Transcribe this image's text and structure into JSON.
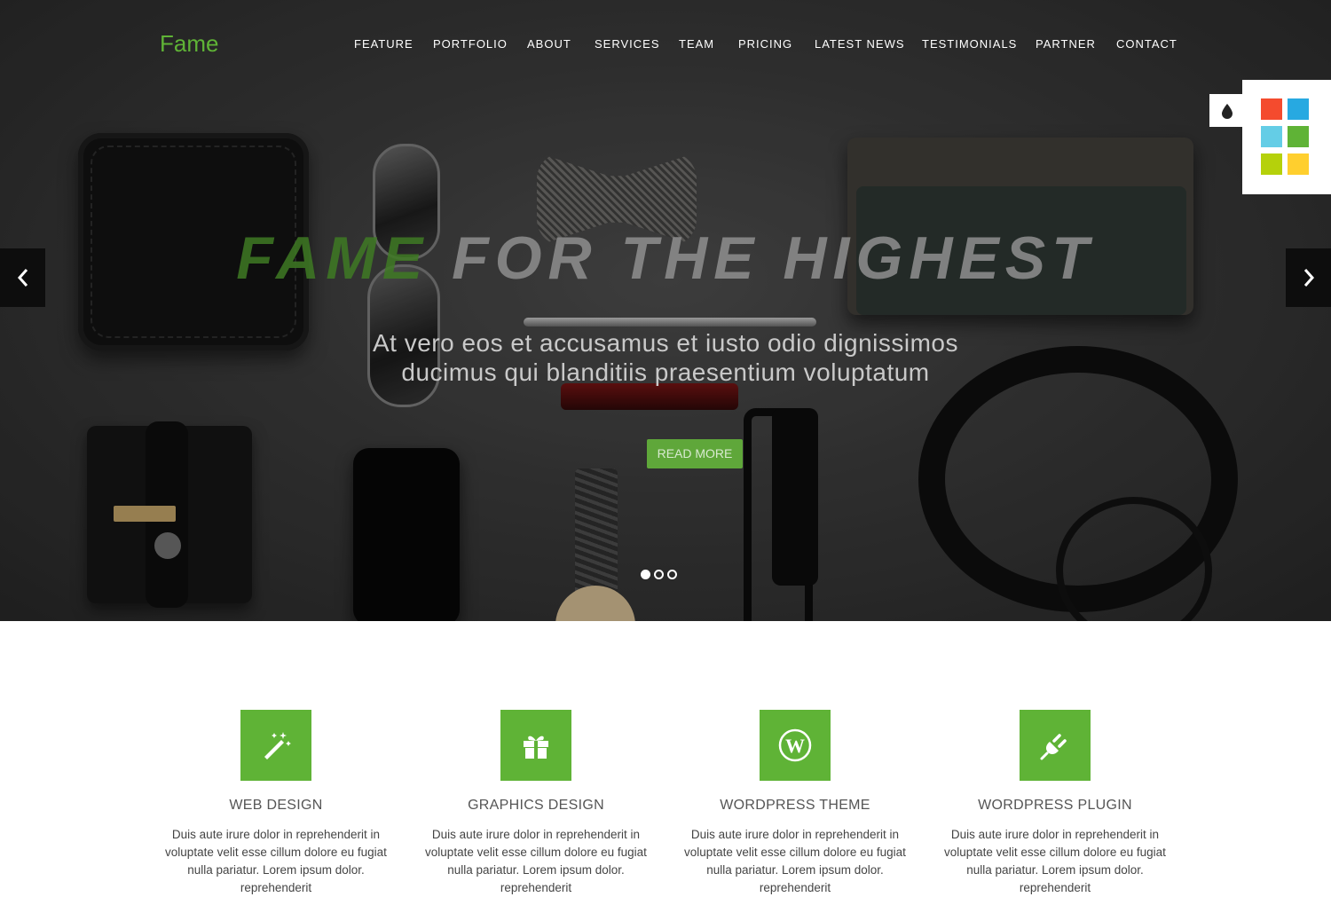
{
  "brand": {
    "logo": "Fame",
    "accent": "#5fb336"
  },
  "nav": {
    "items": [
      "FEATURE",
      "PORTFOLIO",
      "ABOUT",
      "SERVICES",
      "TEAM",
      "PRICING",
      "LATEST NEWS",
      "TESTIMONIALS",
      "PARTNER",
      "CONTACT"
    ]
  },
  "hero": {
    "headline_accent": "FAME",
    "headline_rest": "FOR THE HIGHEST",
    "subtitle_line1": "At vero eos et accusamus et iusto odio dignissimos",
    "subtitle_line2": "ducimus qui blanditiis praesentium voluptatum",
    "button": "READ MORE",
    "prev_icon": "chevron-left-icon",
    "next_icon": "chevron-right-icon",
    "slides": 3,
    "active_slide": 1
  },
  "color_switcher": {
    "toggle_icon": "droplet-icon",
    "swatches": [
      "#f44b2e",
      "#27a9e1",
      "#64cde6",
      "#5fb336",
      "#b5d10b",
      "#ffcf2e"
    ]
  },
  "features": [
    {
      "icon": "magic-wand-icon",
      "title": "WEB DESIGN",
      "desc": "Duis aute irure dolor in reprehenderit in voluptate velit esse cillum dolore eu fugiat nulla pariatur. Lorem ipsum dolor. reprehenderit"
    },
    {
      "icon": "gift-icon",
      "title": "GRAPHICS DESIGN",
      "desc": "Duis aute irure dolor in reprehenderit in voluptate velit esse cillum dolore eu fugiat nulla pariatur. Lorem ipsum dolor. reprehenderit"
    },
    {
      "icon": "wordpress-icon",
      "title": "WORDPRESS THEME",
      "desc": "Duis aute irure dolor in reprehenderit in voluptate velit esse cillum dolore eu fugiat nulla pariatur. Lorem ipsum dolor. reprehenderit"
    },
    {
      "icon": "plug-icon",
      "title": "WORDPRESS PLUGIN",
      "desc": "Duis aute irure dolor in reprehenderit in voluptate velit esse cillum dolore eu fugiat nulla pariatur. Lorem ipsum dolor. reprehenderit"
    }
  ]
}
